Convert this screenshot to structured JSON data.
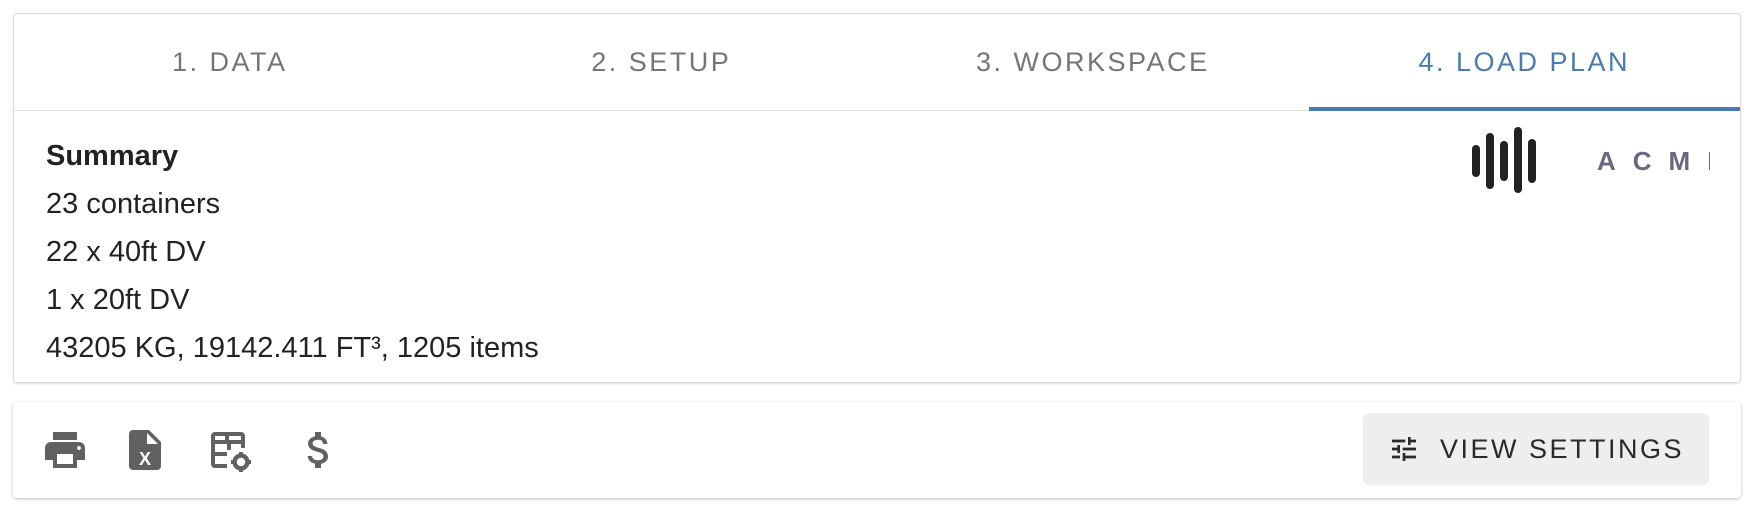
{
  "tabs": [
    {
      "label": "1. DATA",
      "active": false
    },
    {
      "label": "2. SETUP",
      "active": false
    },
    {
      "label": "3. WORKSPACE",
      "active": false
    },
    {
      "label": "4. LOAD PLAN",
      "active": true
    }
  ],
  "summary": {
    "title": "Summary",
    "lines": [
      "23 containers",
      "22 x 40ft DV",
      "1 x 20ft DV",
      "43205 KG, 19142.411 FT³, 1205 items"
    ]
  },
  "logo": {
    "text": "ACME",
    "bar_color": "#222222",
    "text_color": "#6b6780"
  },
  "toolbar": {
    "icons": [
      "print-icon",
      "excel-file-icon",
      "table-settings-icon",
      "dollar-icon"
    ],
    "icon_color": "#616161",
    "view_settings_label": "VIEW SETTINGS",
    "view_settings_icon": "tune-sliders-icon"
  },
  "colors": {
    "accent": "#4a7bb0",
    "tab_inactive": "#757575"
  }
}
